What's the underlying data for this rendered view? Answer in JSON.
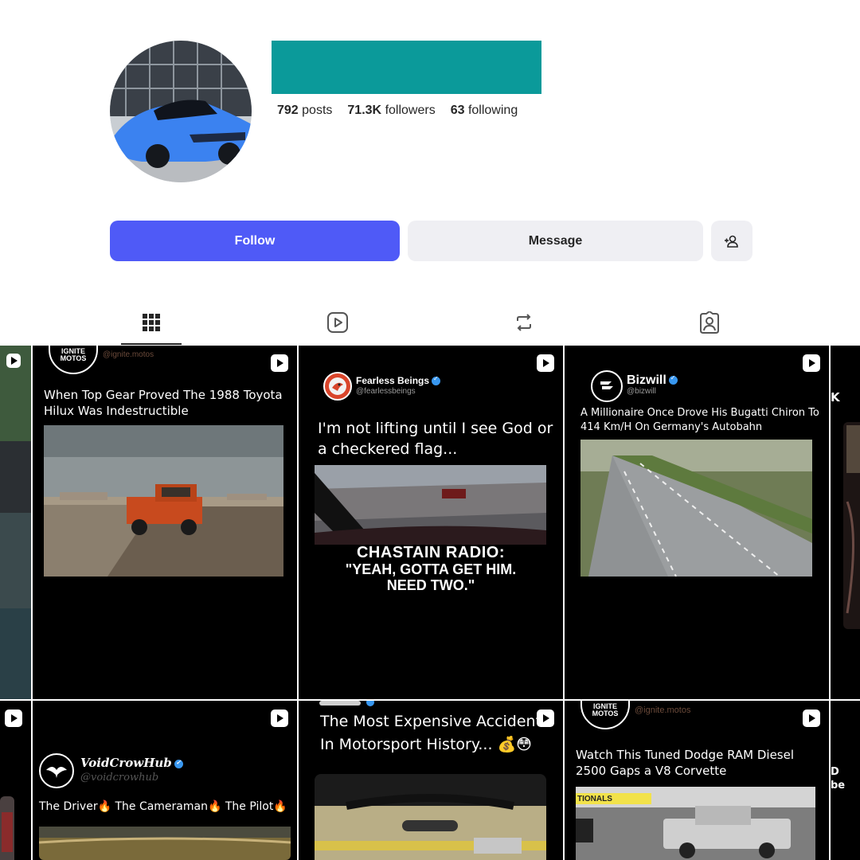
{
  "profile": {
    "stats": {
      "posts_count": "792",
      "posts_label": "posts",
      "followers_count": "71.3K",
      "followers_label": "followers",
      "following_count": "63",
      "following_label": "following"
    },
    "follow_label": "Follow",
    "message_label": "Message"
  },
  "tabs": [
    {
      "icon": "grid-icon",
      "active": true
    },
    {
      "icon": "reels-icon",
      "active": false
    },
    {
      "icon": "repost-icon",
      "active": false
    },
    {
      "icon": "tagged-icon",
      "active": false
    }
  ],
  "colors": {
    "follow_button": "#4f5af7",
    "name_block": "#0b9a9a",
    "secondary_button": "#efeff3",
    "verified_badge": "#3897f0"
  },
  "posts": [
    {
      "account_logo": "IGNITE MOTOS",
      "handle": "@ignite.motos",
      "caption": "When Top Gear Proved The 1988 Toyota Hilux Was Indestructible"
    },
    {
      "account_name": "Fearless Beings",
      "handle": "@fearlessbeings",
      "caption": "I'm not lifting until I see God or a checkered flag...",
      "overlay_line1": "CHASTAIN RADIO:",
      "overlay_line2": "\"YEAH, GOTTA GET HIM.",
      "overlay_line3": "NEED TWO.\""
    },
    {
      "account_name": "Bizwill",
      "handle": "@bizwill",
      "caption": "A Millionaire Once Drove His Bugatti Chiron To 414 Km/H On Germany's Autobahn"
    },
    {
      "account_name": "VoidCrowHub",
      "handle": "@voidcrowhub",
      "caption": "The Driver🔥 The Cameraman🔥 The Pilot🔥"
    },
    {
      "caption": "The Most Expensive Accident In Motorsport History... 💰😳"
    },
    {
      "account_logo": "IGNITE MOTOS",
      "handle": "@ignite.motos",
      "caption": "Watch This Tuned Dodge RAM Diesel 2500 Gaps a V8 Corvette",
      "sign_text": "TIONALS"
    }
  ],
  "edge_tiles": {
    "right_top_letters": "K",
    "right_bottom_letters": "D\nbe"
  }
}
